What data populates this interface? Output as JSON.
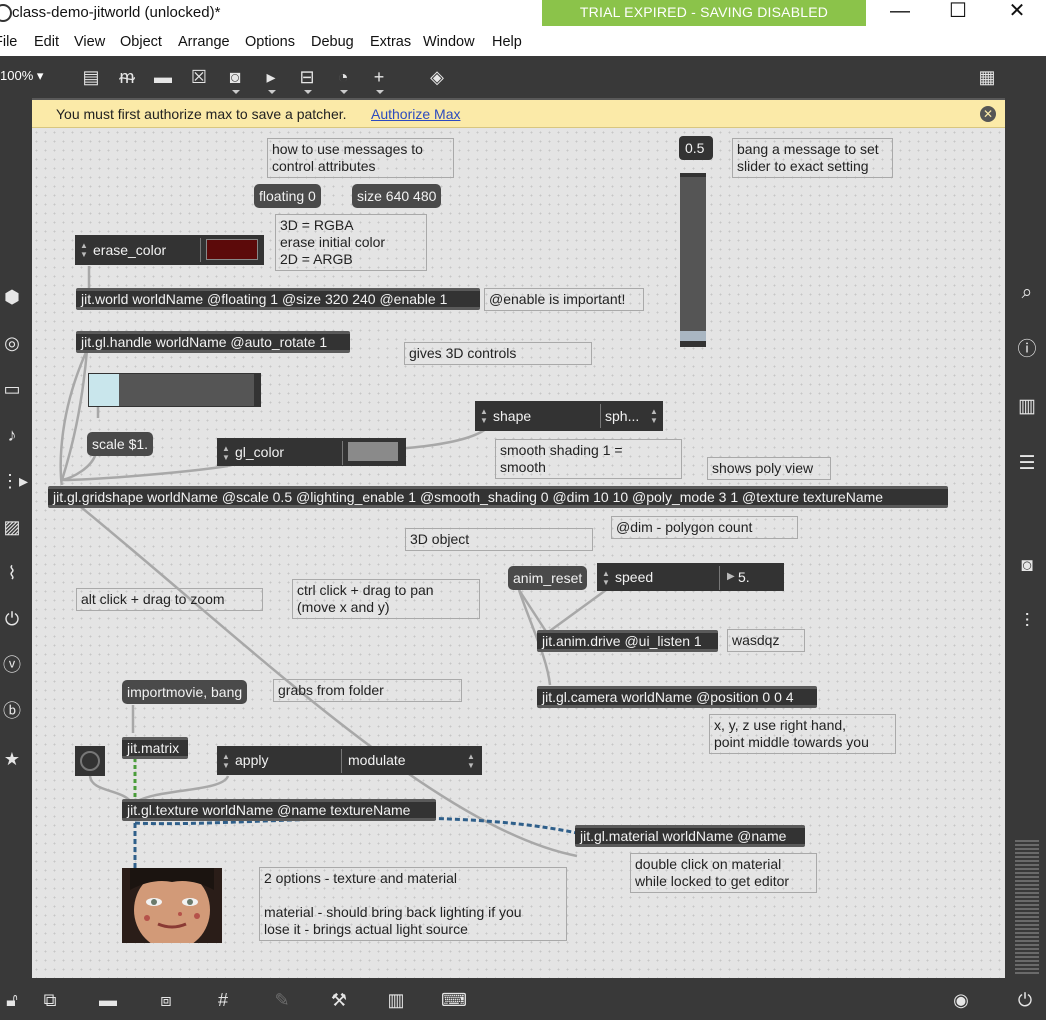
{
  "window": {
    "title": "class-demo-jitworld (unlocked)*",
    "trial_banner": "TRIAL EXPIRED - SAVING DISABLED",
    "minimize": "—",
    "maximize": "☐",
    "close": "✕"
  },
  "menu": [
    "File",
    "Edit",
    "View",
    "Object",
    "Arrange",
    "Options",
    "Debug",
    "Extras",
    "Window",
    "Help"
  ],
  "toolbar": {
    "zoom": "100%",
    "icons": [
      "presentation-icon",
      "comment-icon",
      "message-icon",
      "button-icon",
      "toggle-icon",
      "playbar-icon",
      "number-icon",
      "dial-icon",
      "add-icon",
      "paint-bucket-icon",
      "grid-list-icon"
    ]
  },
  "banner": {
    "text": "You must first authorize max to save a patcher.",
    "link": "Authorize Max",
    "close": "✕"
  },
  "objects": {
    "jit_world": "jit.world worldName @floating 1 @size 320 240 @enable 1",
    "jit_gl_handle": "jit.gl.handle worldName @auto_rotate 1",
    "jit_gl_gridshape": "jit.gl.gridshape worldName @scale 0.5 @lighting_enable 1 @smooth_shading 0 @dim 10 10 @poly_mode 3 1 @texture textureName",
    "jit_anim_drive": "jit.anim.drive @ui_listen 1",
    "jit_gl_camera": "jit.gl.camera worldName @position 0 0 4",
    "jit_matrix": "jit.matrix",
    "jit_gl_texture": "jit.gl.texture worldName @name textureName",
    "jit_gl_material": "jit.gl.material worldName @name"
  },
  "messages": {
    "floating": "floating 0",
    "size": "size 640 480",
    "scale": "scale $1.",
    "anim_reset": "anim_reset",
    "importmovie": "importmovie, bang",
    "number_box": "0.5"
  },
  "attrui": {
    "erase_color": "erase_color",
    "gl_color": "gl_color",
    "shape": "shape",
    "shape_value": "sph...",
    "speed": "speed",
    "speed_value": "5.",
    "apply": "apply",
    "apply_value": "modulate"
  },
  "comments": {
    "how_to": "how to use messages to\ncontrol attributes",
    "rgba": "3D = RGBA\nerase initial color\n2D = ARGB",
    "enable_important": "@enable is important!",
    "bang_message": "bang a message to set\nslider to exact setting",
    "gives_3d": "gives 3D controls",
    "smooth_shading": "smooth shading 1 =\nsmooth",
    "poly_view": "shows poly view",
    "dim": "@dim - polygon count",
    "object_3d": "3D object",
    "zoom": "alt click + drag to zoom",
    "pan": "ctrl click + drag to pan\n(move x and y)",
    "wasdqz": "wasdqz",
    "grabs": "grabs from folder",
    "xyz": "x, y, z use right hand,\npoint middle towards you",
    "two_options": "2 options - texture and material\n\nmaterial - should bring back lighting if you\nlose it - brings actual light source",
    "double_click": "double click on material\nwhile locked to get editor"
  },
  "colors": {
    "erase_swatch": "#5c0a0a",
    "gl_color_swatch": "#8a8a8a",
    "trial_green": "#8bc34a",
    "banner_yellow": "#fbeaa8"
  },
  "left_bar_icons": [
    "cube-icon",
    "circle-target-icon",
    "film-icon",
    "music-note-icon",
    "sequence-icon",
    "image-icon",
    "paperclip-icon",
    "plug-icon",
    "v-icon",
    "b-icon",
    "star-icon"
  ],
  "right_bar_icons": [
    "search-icon",
    "info-icon",
    "book-icon",
    "list-icon",
    "camera-icon",
    "sliders-icon"
  ],
  "bottom_bar_icons": [
    "lock-icon",
    "edit-icon",
    "presentation-icon",
    "windows-icon",
    "grid-icon",
    "pin-icon",
    "wrench-icon",
    "keyboard-icon",
    "keypad-icon",
    "play-icon",
    "power-icon"
  ]
}
